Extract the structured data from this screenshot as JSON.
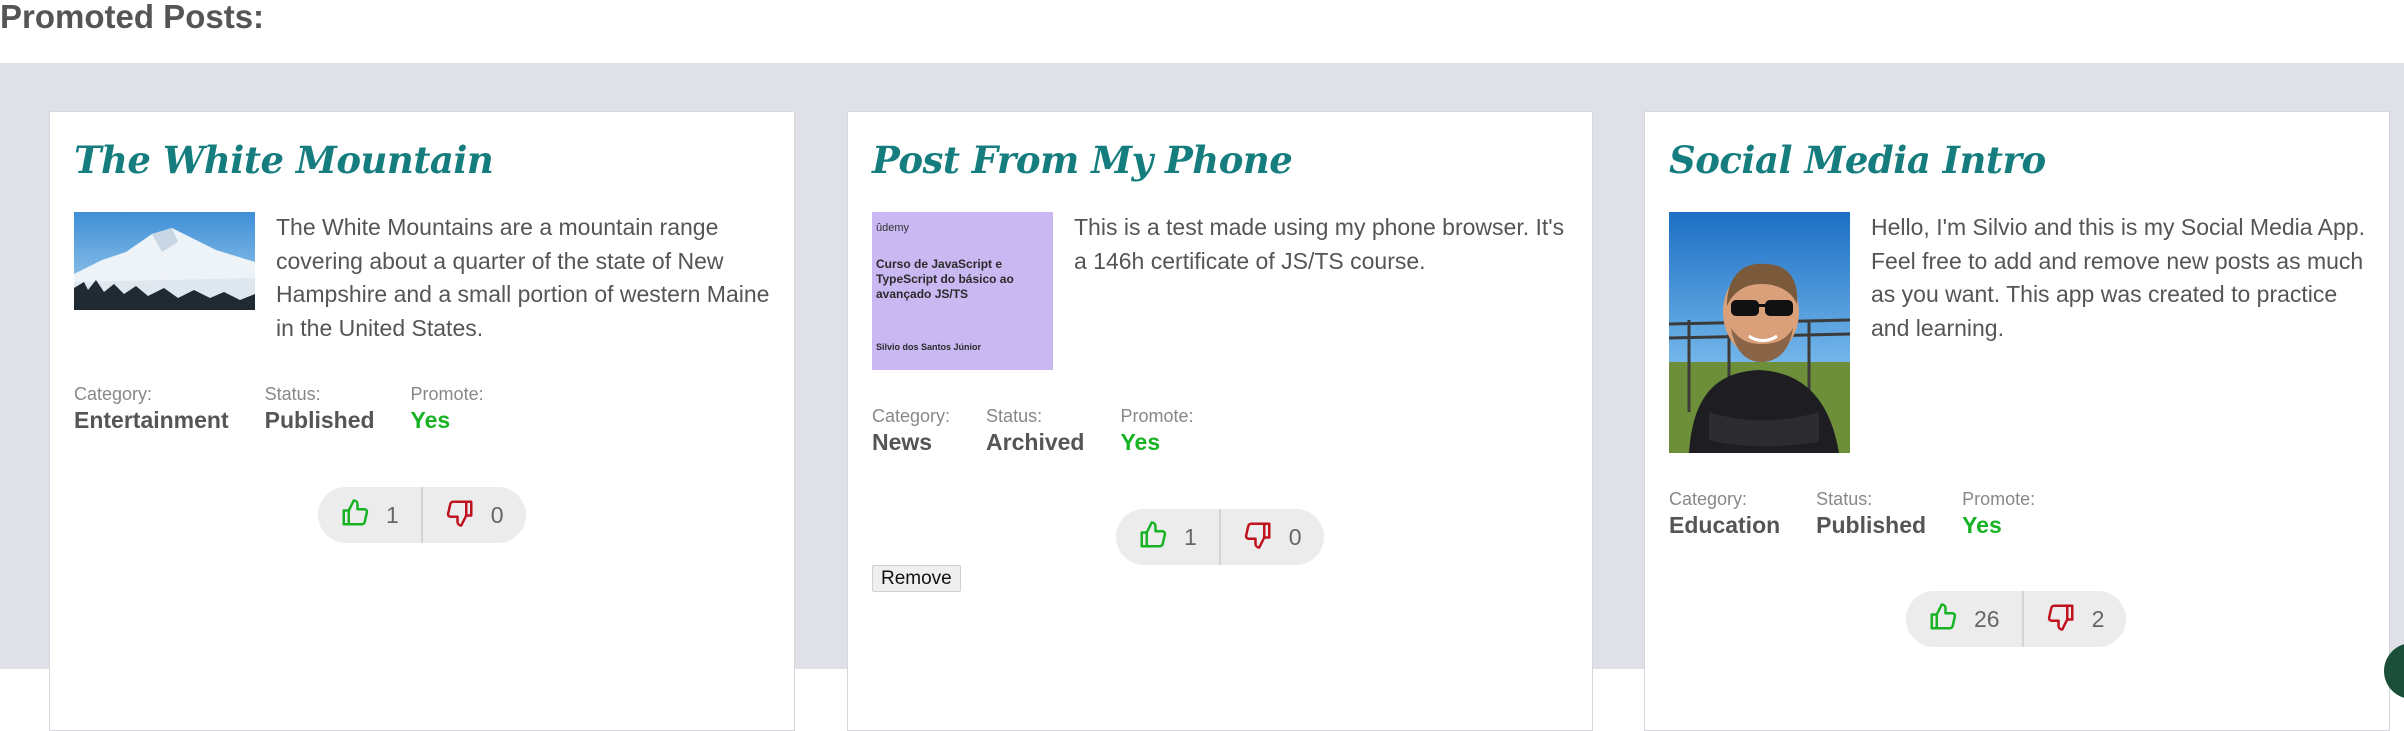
{
  "page": {
    "heading": "Promoted Posts:"
  },
  "labels": {
    "category": "Category:",
    "status": "Status:",
    "promote": "Promote:"
  },
  "posts": [
    {
      "title": "The White Mountain",
      "text": "The White Mountains are a mountain range covering about a quarter of the state of New Hampshire and a small portion of western Maine in the United States.",
      "image": "mountain-photo",
      "category": "Entertainment",
      "status": "Published",
      "promote": "Yes",
      "likes": "1",
      "dislikes": "0"
    },
    {
      "title": "Post From My Phone",
      "text": "This is a test made using my phone browser. It's a 146h certificate of JS/TS course.",
      "image": "certificate-photo",
      "image_text": {
        "brand": "ûdemy",
        "course": "Curso de JavaScript e TypeScript do básico ao avançado JS/TS",
        "student": "Silvio dos Santos Júnior"
      },
      "category": "News",
      "status": "Archived",
      "promote": "Yes",
      "likes": "1",
      "dislikes": "0",
      "remove_label": "Remove"
    },
    {
      "title": "Social Media Intro",
      "text": "Hello, I'm Silvio and this is my Social Media App. Feel free to add and remove new posts as much as you want. This app was created to practice and learning.",
      "image": "profile-photo",
      "category": "Education",
      "status": "Published",
      "promote": "Yes",
      "likes": "26",
      "dislikes": "2"
    }
  ],
  "colors": {
    "title": "#167d7f",
    "like": "#17b324",
    "dislike": "#c0111f",
    "background": "#e0e1e8"
  },
  "icons": {
    "like": "thumbs-up-icon",
    "dislike": "thumbs-down-icon"
  }
}
